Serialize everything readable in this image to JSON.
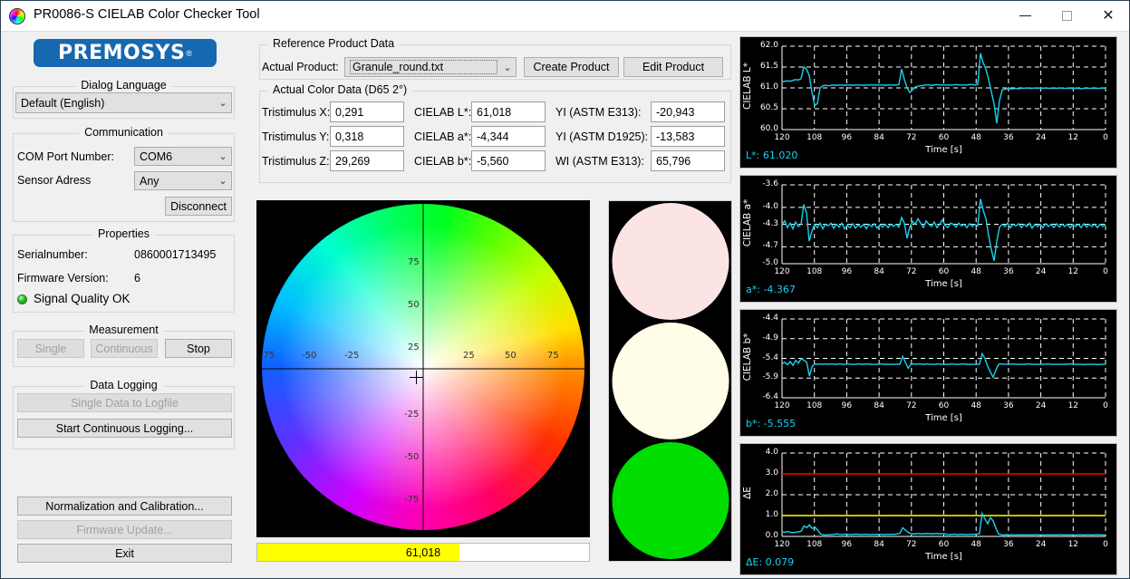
{
  "window": {
    "title": "PR0086-S CIELAB Color Checker Tool",
    "icon": "color-wheel-icon",
    "minimize_label": "—",
    "maximize_label": "□",
    "close_label": "✕"
  },
  "brand": {
    "name": "PREMOSYS",
    "registered": "®",
    "color": "#1668b0"
  },
  "dialog_language": {
    "legend": "Dialog Language",
    "selected": "Default (English)",
    "options": [
      "Default (English)"
    ]
  },
  "communication": {
    "legend": "Communication",
    "com_port_label": "COM Port Number:",
    "com_port_value": "COM6",
    "com_port_options": [
      "COM6"
    ],
    "sensor_address_label": "Sensor Adress",
    "sensor_address_value": "Any",
    "sensor_address_options": [
      "Any"
    ],
    "disconnect_label": "Disconnect"
  },
  "properties": {
    "legend": "Properties",
    "serial_label": "Serialnumber:",
    "serial_value": "0860001713495",
    "firmware_label": "Firmware Version:",
    "firmware_value": "6",
    "signal_status": "Signal Quality OK",
    "signal_color": "#22c322"
  },
  "measurement": {
    "legend": "Measurement",
    "single_label": "Single",
    "continuous_label": "Continuous",
    "stop_label": "Stop"
  },
  "data_logging": {
    "legend": "Data Logging",
    "single_data_label": "Single Data to Logfile",
    "continuous_label": "Start Continuous Logging..."
  },
  "bottom_actions": {
    "normalization_label": "Normalization and Calibration...",
    "firmware_update_label": "Firmware Update...",
    "exit_label": "Exit"
  },
  "reference_product": {
    "legend": "Reference Product Data",
    "actual_product_label": "Actual Product:",
    "actual_product_value": "Granule_round.txt",
    "actual_product_options": [
      "Granule_round.txt"
    ],
    "create_label": "Create Product",
    "edit_label": "Edit Product"
  },
  "color_data": {
    "legend": "Actual Color Data (D65 2°)",
    "rows": [
      {
        "l1": "Tristimulus X:",
        "v1": "0,291",
        "l2": "CIELAB L*:",
        "v2": "61,018",
        "l3": "YI (ASTM E313):",
        "v3": "-20,943"
      },
      {
        "l1": "Tristimulus Y:",
        "v1": "0,318",
        "l2": "CIELAB a*:",
        "v2": "-4,344",
        "l3": "YI (ASTM D1925):",
        "v3": "-13,583"
      },
      {
        "l1": "Tristimulus Z:",
        "v1": "29,269",
        "l2": "CIELAB b*:",
        "v2": "-5,560",
        "l3": "WI (ASTM E313):",
        "v3": "65,796"
      }
    ]
  },
  "color_wheel": {
    "ticks_positive": [
      "25",
      "50",
      "75"
    ],
    "ticks_negative": [
      "-25",
      "-50",
      "-75"
    ],
    "marker_a": -4.344,
    "marker_b": -5.56
  },
  "progress": {
    "value_text": "61,018",
    "value": 61.018,
    "max": 100,
    "fill_color": "#ffff00"
  },
  "swatches": [
    {
      "name": "reference-color-swatch",
      "color": "#fde4e4"
    },
    {
      "name": "measured-color-swatch",
      "color": "#fffde8"
    },
    {
      "name": "status-color-swatch",
      "color": "#00dd00"
    }
  ],
  "chart_data": [
    {
      "type": "line",
      "name": "cielab-l-chart",
      "title": "",
      "ylabel": "CIELAB L*",
      "xlabel": "Time [s]",
      "readout": "L*: 61.020",
      "ylim": [
        60.0,
        62.0
      ],
      "yticks": [
        "60.0",
        "60.5",
        "61.0",
        "61.5",
        "62.0"
      ],
      "ytick_values": [
        60.0,
        60.5,
        61.0,
        61.5,
        62.0
      ],
      "xlim": [
        120,
        0
      ],
      "xticks": [
        "120",
        "108",
        "96",
        "84",
        "72",
        "60",
        "48",
        "36",
        "24",
        "12",
        "0"
      ],
      "grid": true,
      "series_color": "#19d2ee",
      "values": [
        61.15,
        61.16,
        61.17,
        61.16,
        61.18,
        61.2,
        61.19,
        61.22,
        61.5,
        61.45,
        61.3,
        60.9,
        60.58,
        60.62,
        61.0,
        61.05,
        61.06,
        61.05,
        61.06,
        61.07,
        61.06,
        61.07,
        61.07,
        61.06,
        61.07,
        61.07,
        61.06,
        61.07,
        61.07,
        61.07,
        61.06,
        61.07,
        61.07,
        61.07,
        61.07,
        61.07,
        61.07,
        61.07,
        61.06,
        61.07,
        61.07,
        61.07,
        61.07,
        61.08,
        61.45,
        61.2,
        61.0,
        60.89,
        60.95,
        61.02,
        61.04,
        61.05,
        61.06,
        61.07,
        61.07,
        61.06,
        61.07,
        61.08,
        61.07,
        61.07,
        61.07,
        61.07,
        61.07,
        61.07,
        61.08,
        61.07,
        61.07,
        61.07,
        61.07,
        61.08,
        61.08,
        61.07,
        61.08,
        61.83,
        61.6,
        61.45,
        61.2,
        60.9,
        60.62,
        60.15,
        60.7,
        60.95,
        60.97,
        60.98,
        60.98,
        60.98,
        60.99,
        60.98,
        60.99,
        60.99,
        61.0,
        60.99,
        60.99,
        61.0,
        60.99,
        61.0,
        60.99,
        61.0,
        60.99,
        60.99,
        60.99,
        60.99,
        61.0,
        60.99,
        60.99,
        60.99,
        60.99,
        60.99,
        60.99,
        60.99,
        60.98,
        60.99,
        60.99,
        60.99,
        60.99,
        60.99,
        60.99,
        60.99,
        61.0,
        60.99
      ]
    },
    {
      "type": "line",
      "name": "cielab-a-chart",
      "title": "",
      "ylabel": "CIELAB a*",
      "xlabel": "Time [s]",
      "readout": "a*: -4.367",
      "ylim": [
        -5.0,
        -3.6
      ],
      "yticks": [
        "-3.6",
        "-4.0",
        "-4.3",
        "-4.7",
        "-5.0"
      ],
      "ytick_values": [
        -3.6,
        -4.0,
        -4.3,
        -4.7,
        -5.0
      ],
      "xlim": [
        120,
        0
      ],
      "xticks": [
        "120",
        "108",
        "96",
        "84",
        "72",
        "60",
        "48",
        "36",
        "24",
        "12",
        "0"
      ],
      "grid": true,
      "series_color": "#19d2ee",
      "values": [
        -4.3,
        -4.24,
        -4.36,
        -4.28,
        -4.38,
        -4.26,
        -4.34,
        -4.3,
        -3.95,
        -4.1,
        -4.6,
        -4.42,
        -4.3,
        -4.36,
        -4.28,
        -4.38,
        -4.3,
        -4.33,
        -4.28,
        -4.37,
        -4.3,
        -4.35,
        -4.28,
        -4.38,
        -4.32,
        -4.36,
        -4.29,
        -4.37,
        -4.31,
        -4.35,
        -4.3,
        -4.38,
        -4.3,
        -4.34,
        -4.29,
        -4.37,
        -4.31,
        -4.35,
        -4.3,
        -4.36,
        -4.3,
        -4.34,
        -4.3,
        -4.35,
        -4.18,
        -4.28,
        -4.55,
        -4.35,
        -4.25,
        -4.3,
        -4.2,
        -4.28,
        -4.36,
        -4.24,
        -4.3,
        -4.34,
        -4.26,
        -4.36,
        -4.3,
        -4.22,
        -4.32,
        -4.36,
        -4.28,
        -4.3,
        -4.35,
        -4.28,
        -4.33,
        -4.3,
        -4.36,
        -4.29,
        -4.34,
        -4.3,
        -4.33,
        -3.85,
        -4.05,
        -4.2,
        -4.5,
        -4.75,
        -4.95,
        -4.6,
        -4.35,
        -4.3,
        -4.34,
        -4.28,
        -4.36,
        -4.3,
        -4.33,
        -4.29,
        -4.36,
        -4.3,
        -4.34,
        -4.28,
        -4.37,
        -4.3,
        -4.34,
        -4.3,
        -4.36,
        -4.29,
        -4.34,
        -4.3,
        -4.36,
        -4.29,
        -4.35,
        -4.3,
        -4.34,
        -4.3,
        -4.36,
        -4.3,
        -4.34,
        -4.3,
        -4.36,
        -4.29,
        -4.35,
        -4.3,
        -4.34,
        -4.3,
        -4.36,
        -4.3,
        -4.34,
        -4.3
      ]
    },
    {
      "type": "line",
      "name": "cielab-b-chart",
      "title": "",
      "ylabel": "CIELAB b*",
      "xlabel": "Time [s]",
      "readout": "b*: -5.555",
      "ylim": [
        -6.4,
        -4.4
      ],
      "yticks": [
        "-4.4",
        "-4.9",
        "-5.4",
        "-5.9",
        "-6.4"
      ],
      "ytick_values": [
        -4.4,
        -4.9,
        -5.4,
        -5.9,
        -6.4
      ],
      "xlim": [
        120,
        0
      ],
      "xticks": [
        "120",
        "108",
        "96",
        "84",
        "72",
        "60",
        "48",
        "36",
        "24",
        "12",
        "0"
      ],
      "grid": true,
      "series_color": "#19d2ee",
      "values": [
        -5.54,
        -5.5,
        -5.56,
        -5.48,
        -5.58,
        -5.45,
        -5.52,
        -5.4,
        -5.45,
        -5.5,
        -5.85,
        -5.6,
        -5.54,
        -5.55,
        -5.54,
        -5.55,
        -5.54,
        -5.55,
        -5.54,
        -5.55,
        -5.55,
        -5.54,
        -5.55,
        -5.55,
        -5.54,
        -5.55,
        -5.55,
        -5.55,
        -5.54,
        -5.55,
        -5.55,
        -5.54,
        -5.55,
        -5.55,
        -5.55,
        -5.55,
        -5.54,
        -5.55,
        -5.55,
        -5.55,
        -5.55,
        -5.55,
        -5.55,
        -5.55,
        -5.35,
        -5.5,
        -5.65,
        -5.55,
        -5.54,
        -5.55,
        -5.54,
        -5.55,
        -5.55,
        -5.54,
        -5.55,
        -5.55,
        -5.55,
        -5.54,
        -5.55,
        -5.55,
        -5.55,
        -5.55,
        -5.54,
        -5.55,
        -5.55,
        -5.55,
        -5.54,
        -5.55,
        -5.55,
        -5.55,
        -5.55,
        -5.55,
        -5.55,
        -5.28,
        -5.4,
        -5.6,
        -5.75,
        -5.88,
        -5.7,
        -5.55,
        -5.54,
        -5.55,
        -5.55,
        -5.55,
        -5.54,
        -5.55,
        -5.55,
        -5.55,
        -5.55,
        -5.55,
        -5.54,
        -5.55,
        -5.55,
        -5.55,
        -5.55,
        -5.55,
        -5.55,
        -5.54,
        -5.55,
        -5.55,
        -5.55,
        -5.55,
        -5.55,
        -5.55,
        -5.55,
        -5.54,
        -5.55,
        -5.55,
        -5.55,
        -5.55,
        -5.56,
        -5.55,
        -5.55,
        -5.55,
        -5.55,
        -5.56,
        -5.55,
        -5.55,
        -5.55
      ]
    },
    {
      "type": "line",
      "name": "delta-e-chart",
      "title": "",
      "ylabel": "ΔE",
      "xlabel": "Time [s]",
      "readout": "ΔE: 0.079",
      "ylim": [
        0.0,
        4.0
      ],
      "yticks": [
        "0.0",
        "1.0",
        "2.0",
        "3.0",
        "4.0"
      ],
      "ytick_values": [
        0.0,
        1.0,
        2.0,
        3.0,
        4.0
      ],
      "xlim": [
        120,
        0
      ],
      "xticks": [
        "120",
        "108",
        "96",
        "84",
        "72",
        "60",
        "48",
        "36",
        "24",
        "12",
        "0"
      ],
      "grid": true,
      "series_color": "#19d2ee",
      "threshold_lines": [
        {
          "value": 3.0,
          "color": "#ff0000",
          "name": "upper-threshold-line"
        },
        {
          "value": 1.0,
          "color": "#ffff00",
          "name": "warning-threshold-line"
        }
      ],
      "values": [
        0.22,
        0.2,
        0.24,
        0.2,
        0.18,
        0.2,
        0.22,
        0.25,
        0.5,
        0.42,
        0.55,
        0.38,
        0.45,
        0.3,
        0.12,
        0.08,
        0.07,
        0.08,
        0.09,
        0.1,
        0.12,
        0.1,
        0.09,
        0.11,
        0.1,
        0.09,
        0.1,
        0.11,
        0.1,
        0.09,
        0.1,
        0.1,
        0.09,
        0.1,
        0.1,
        0.1,
        0.1,
        0.09,
        0.1,
        0.1,
        0.1,
        0.1,
        0.12,
        0.15,
        0.42,
        0.3,
        0.2,
        0.14,
        0.12,
        0.13,
        0.14,
        0.12,
        0.13,
        0.14,
        0.13,
        0.12,
        0.14,
        0.13,
        0.12,
        0.14,
        0.1,
        0.09,
        0.1,
        0.11,
        0.09,
        0.1,
        0.1,
        0.09,
        0.1,
        0.1,
        0.1,
        0.11,
        0.12,
        1.1,
        0.85,
        0.6,
        0.9,
        0.75,
        0.4,
        0.12,
        0.08,
        0.07,
        0.08,
        0.07,
        0.08,
        0.07,
        0.08,
        0.07,
        0.08,
        0.07,
        0.08,
        0.07,
        0.08,
        0.08,
        0.07,
        0.08,
        0.07,
        0.08,
        0.07,
        0.08,
        0.07,
        0.08,
        0.08,
        0.07,
        0.08,
        0.07,
        0.08,
        0.07,
        0.08,
        0.08,
        0.07,
        0.08,
        0.08,
        0.07,
        0.08,
        0.08,
        0.08,
        0.07,
        0.079
      ]
    }
  ]
}
